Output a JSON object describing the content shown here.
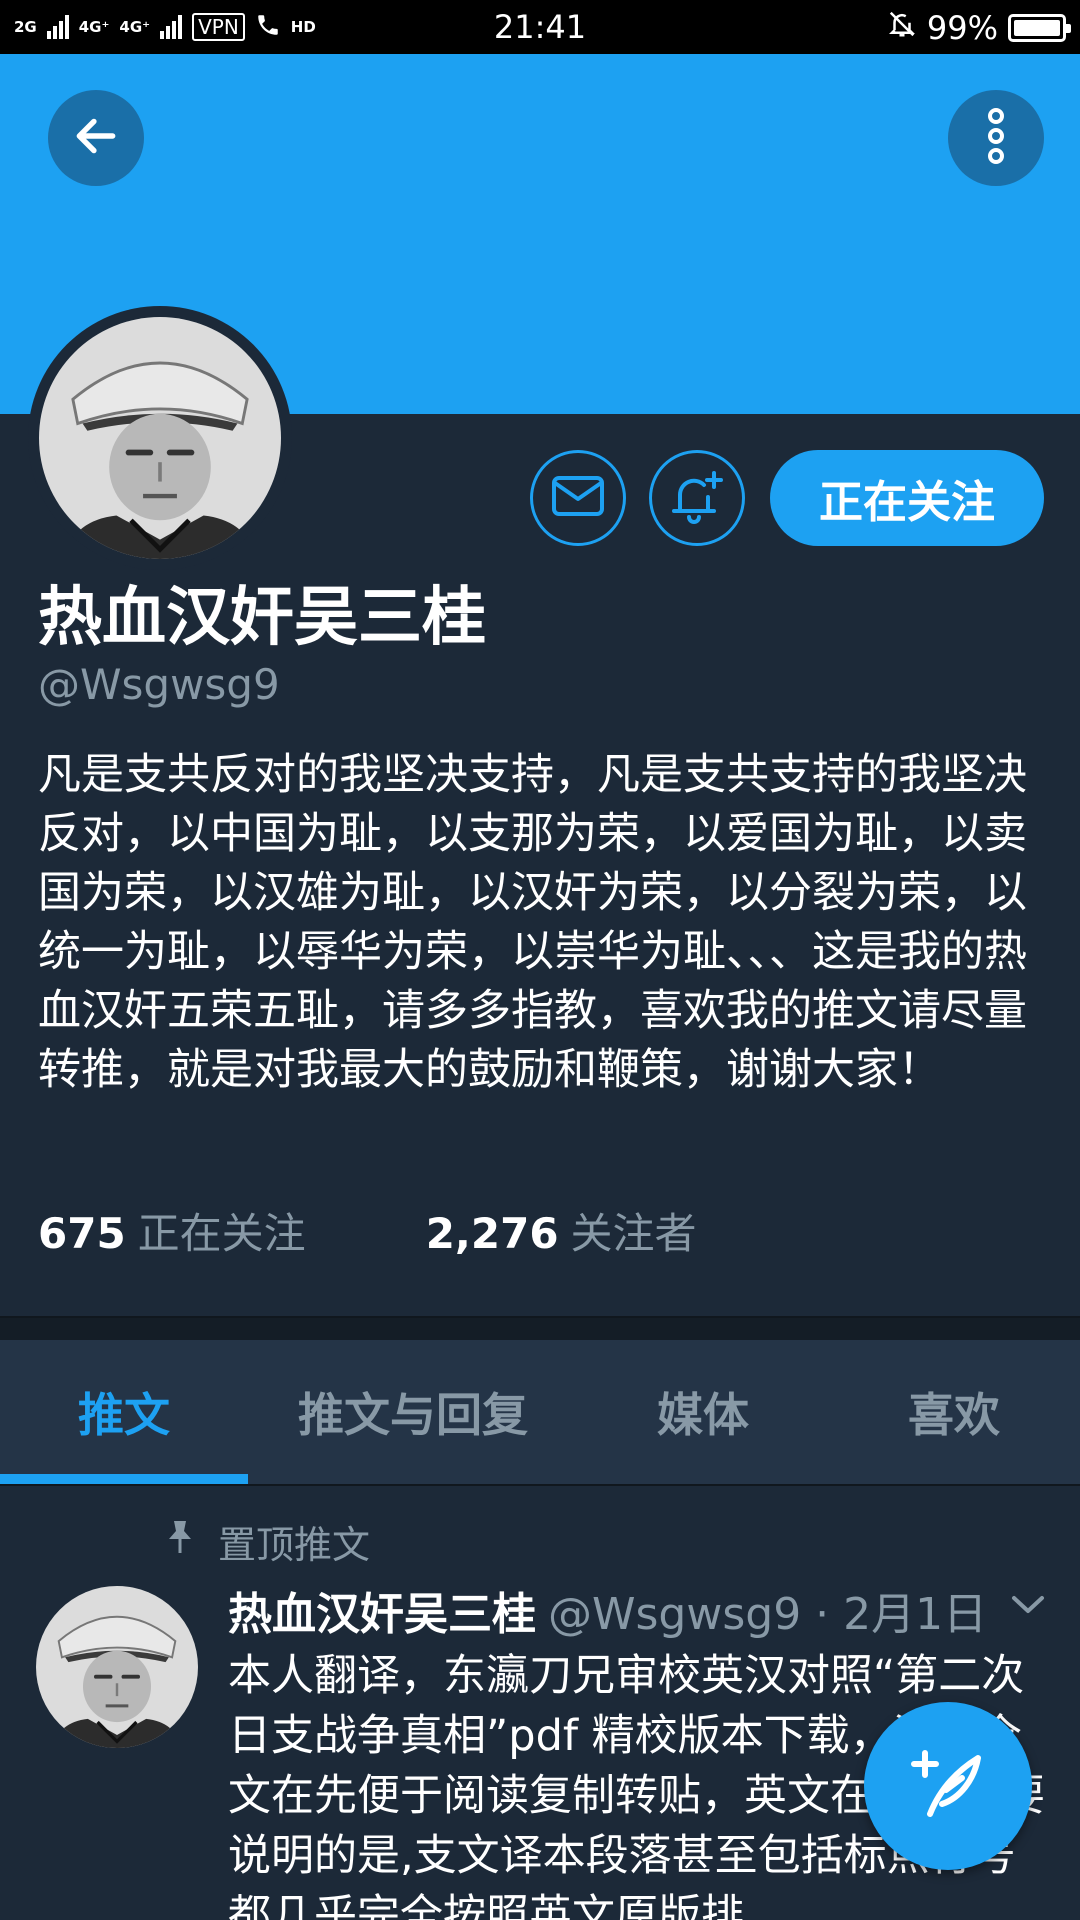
{
  "status_bar": {
    "network_1": "2G",
    "network_2": "4G⁺",
    "network_3": "4G⁺",
    "vpn": "VPN",
    "hd": "HD",
    "time": "21:41",
    "battery": "99%",
    "battery_level": 0.99
  },
  "profile": {
    "display_name": "热血汉奸吴三桂",
    "handle": "@Wsgwsg9",
    "follow_button": "正在关注",
    "bio": "凡是支共反对的我坚决支持，凡是支共支持的我坚决反对，以中国为耻，以支那为荣，以爱国为耻，以卖国为荣，以汉雄为耻，以汉奸为荣，以分裂为荣，以统一为耻，以辱华为荣，以崇华为耻、、、这是我的热血汉奸五荣五耻，请多多指教，喜欢我的推文请尽量转推，就是对我最大的鼓励和鞭策，谢谢大家！",
    "following_count": "675",
    "following_label": "正在关注",
    "followers_count": "2,276",
    "followers_label": "关注者"
  },
  "tabs": [
    {
      "label": "推文",
      "active": true
    },
    {
      "label": "推文与回复",
      "active": false
    },
    {
      "label": "媒体",
      "active": false
    },
    {
      "label": "喜欢",
      "active": false
    }
  ],
  "tweet": {
    "pinned_label": "置顶推文",
    "name": "热血汉奸吴三桂",
    "handle_date": "@Wsgwsg9 · 2月1日",
    "text": "本人翻译，东瀛刀兄审校英汉对照“第二次日支战争真相”pdf 精校版本下载，汉文全文在先便于阅读复制转贴，英文在后。需要说明的是,支文译本段落甚至包括标点符号都几乎完全按照英文原版排"
  },
  "icons": {
    "back": "arrow-left-icon",
    "more": "more-vertical-icon",
    "mail": "mail-icon",
    "notify": "bell-plus-icon",
    "pin": "pin-icon",
    "caret": "chevron-down-icon",
    "compose": "compose-feather-icon"
  },
  "colors": {
    "accent": "#1da1f2",
    "background": "#1c2938",
    "tab_background": "#243447",
    "muted_text": "#8899a6"
  }
}
